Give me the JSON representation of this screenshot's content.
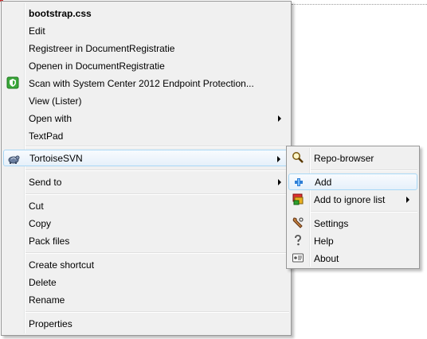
{
  "context_menu": {
    "items": {
      "bootstrap": "bootstrap.css",
      "edit": "Edit",
      "registreer": "Registreer in DocumentRegistratie",
      "openen": "Openen in DocumentRegistratie",
      "scan": "Scan with System Center 2012 Endpoint Protection...",
      "view": "View (Lister)",
      "open_with": "Open with",
      "textpad": "TextPad",
      "tortoise": "TortoiseSVN",
      "send_to": "Send to",
      "cut": "Cut",
      "copy": "Copy",
      "pack": "Pack files",
      "shortcut": "Create shortcut",
      "delete": "Delete",
      "rename": "Rename",
      "properties": "Properties"
    }
  },
  "tortoise_submenu": {
    "items": {
      "repo": "Repo-browser",
      "add": "Add",
      "ignore": "Add to ignore list",
      "settings": "Settings",
      "help": "Help",
      "about": "About"
    }
  },
  "icons": {
    "scan": "shield-icon",
    "tortoise": "tortoise-icon",
    "repo": "magnifier-icon",
    "add": "plus-icon",
    "ignore": "ignore-list-icon",
    "settings": "wrench-icon",
    "help": "question-icon",
    "about": "about-icon"
  },
  "colors": {
    "highlight_border": "#a8d8f6",
    "menu_bg": "#f0f0f0"
  }
}
